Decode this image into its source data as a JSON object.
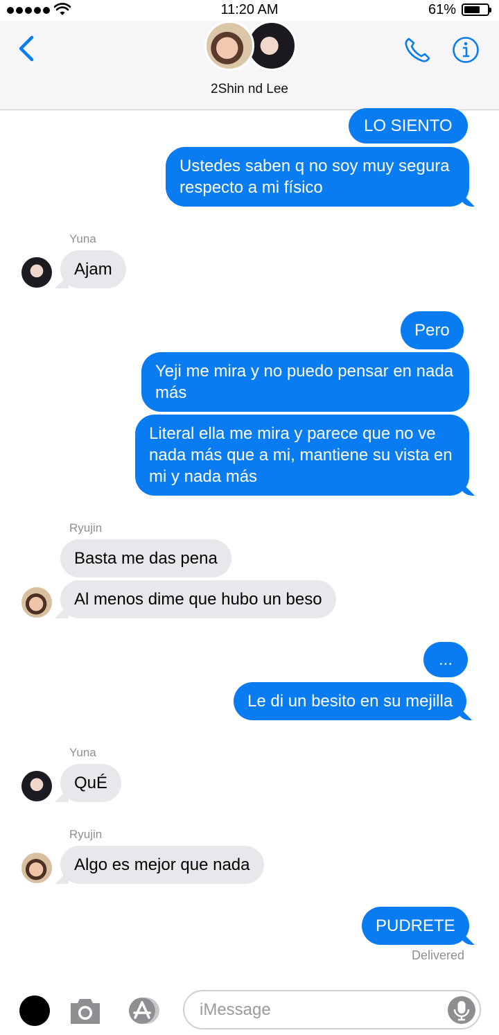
{
  "status_bar": {
    "time": "11:20 AM",
    "battery": "61%"
  },
  "header": {
    "group_name": "2Shin nd Lee"
  },
  "messages": [
    {
      "from": "me",
      "text": "LO SIENTO"
    },
    {
      "from": "me",
      "text": "Ustedes saben q no soy muy segura respecto a mi físico"
    },
    {
      "from": "Yuna",
      "text": "Ajam"
    },
    {
      "from": "me",
      "text": "Pero"
    },
    {
      "from": "me",
      "text": "Yeji me mira y no puedo pensar en nada más"
    },
    {
      "from": "me",
      "text": "Literal ella me mira y parece que no ve nada más que a mi, mantiene su vista en mi y nada más"
    },
    {
      "from": "Ryujin",
      "text": "Basta me das pena"
    },
    {
      "from": "Ryujin",
      "text": "Al menos dime que hubo un beso"
    },
    {
      "from": "me",
      "text": "..."
    },
    {
      "from": "me",
      "text": "Le di un besito en su mejilla"
    },
    {
      "from": "Yuna",
      "text": "QuÉ"
    },
    {
      "from": "Ryujin",
      "text": "Algo es mejor que nada"
    },
    {
      "from": "me",
      "text": "PUDRETE"
    }
  ],
  "senders": {
    "yuna": "Yuna",
    "ryujin": "Ryujin"
  },
  "delivered": "Delivered",
  "input": {
    "placeholder": "iMessage",
    "value": ""
  },
  "colors": {
    "sent_bubble": "#0a7cf2",
    "received_bubble": "#e8e8ec",
    "accent": "#0a7cf2"
  },
  "icons": [
    "back-chevron-icon",
    "phone-icon",
    "info-icon",
    "camera-icon",
    "appstore-icon",
    "mic-icon"
  ]
}
